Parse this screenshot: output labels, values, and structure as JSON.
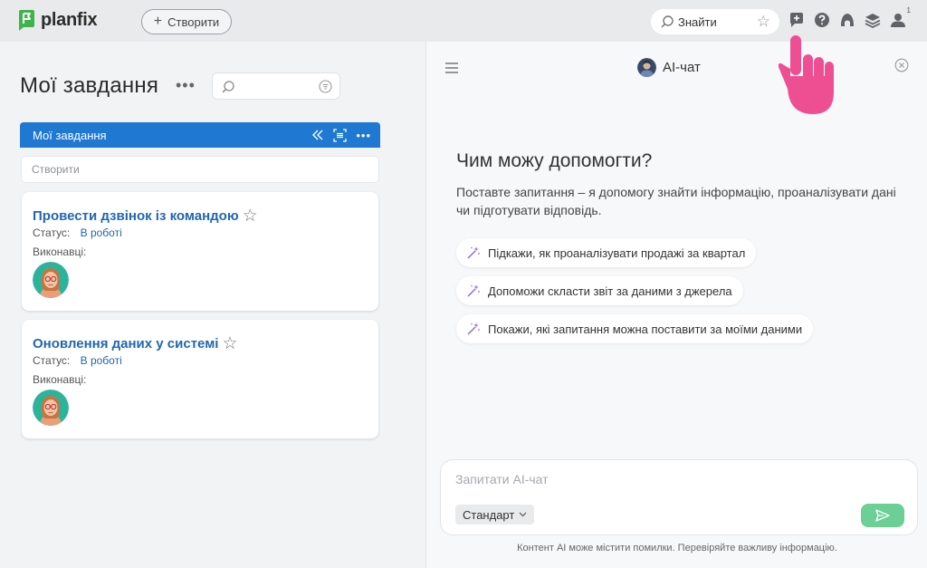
{
  "app": {
    "logo_text": "planfix",
    "brand_color": "#1f78d1",
    "logo_color": "#3fb44c"
  },
  "topbar": {
    "create_label": "Створити",
    "search_placeholder": "Знайти",
    "icons": [
      "add-message-icon",
      "help-icon",
      "lamp-icon",
      "layers-icon",
      "user-icon"
    ],
    "user_badge": "1"
  },
  "left": {
    "page_title": "Мої завдання",
    "more_label": "•••",
    "list_header": "Мої завдання",
    "create_placeholder": "Створити",
    "tasks": [
      {
        "title": "Провести дзвінок із командою",
        "status_label": "Статус:",
        "status_value": "В роботі",
        "executors_label": "Виконавці:"
      },
      {
        "title": "Оновлення даних у системі",
        "status_label": "Статус:",
        "status_value": "В роботі",
        "executors_label": "Виконавці:"
      }
    ]
  },
  "chat": {
    "title": "AI-чат",
    "help_title": "Чим можу допомогти?",
    "help_sub": "Поставте запитання – я допомогу знайти інформацію, проаналізувати дані чи підготувати відповідь.",
    "suggestions": [
      "Підкажи, як проаналізувати продажі за квартал",
      "Допоможи скласти звіт за даними з джерела",
      "Покажи, які запитання можна поставити за моїми даними"
    ],
    "input_placeholder": "Запитати AI-чат",
    "mode": "Стандарт",
    "disclaimer": "Контент AI може містити помилки. Перевіряйте важливу інформацію.",
    "send_color": "#6ccf95"
  }
}
